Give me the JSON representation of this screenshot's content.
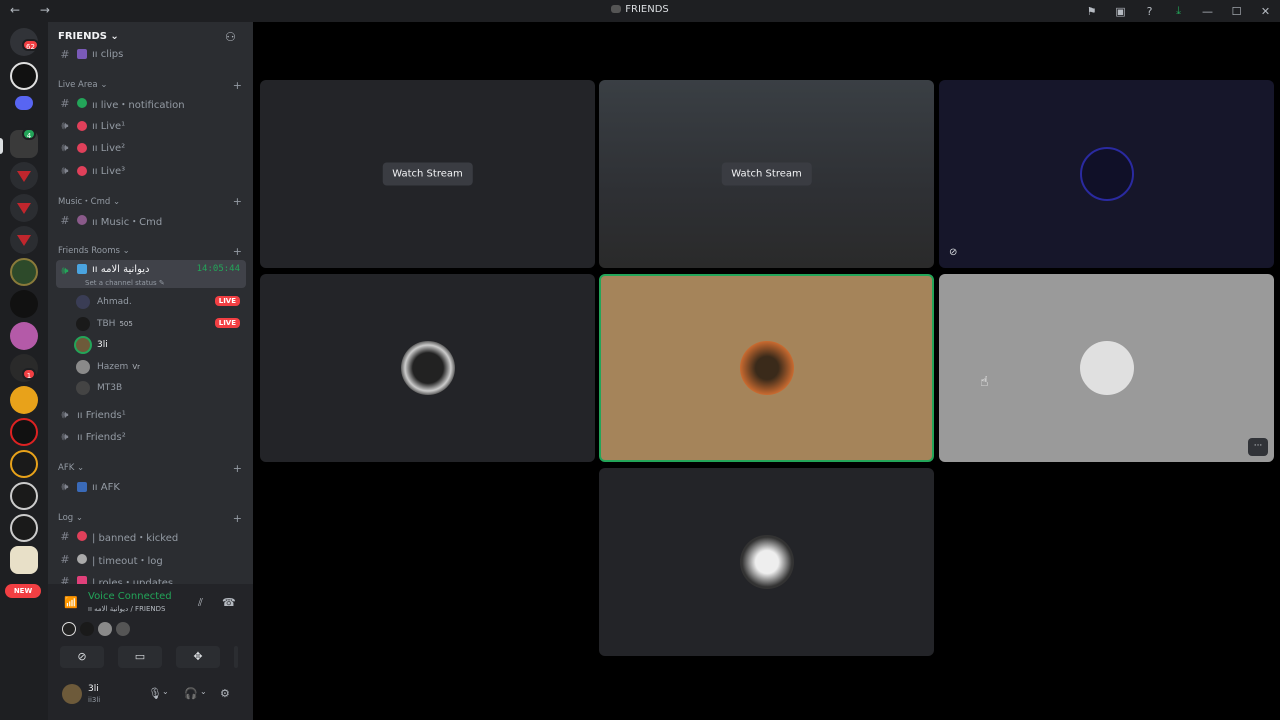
{
  "window": {
    "title": "FRIENDS",
    "nav": "← →"
  },
  "titlebar_icons": [
    "flag-icon",
    "screen-icon",
    "help-icon",
    "download-icon",
    "minimize-icon",
    "maximize-icon",
    "close-icon"
  ],
  "guilds": {
    "dm_badge": "62",
    "badge_4": "4",
    "badge_1": "1",
    "new_label": "NEW"
  },
  "server": {
    "name": "FRIENDS ⌄",
    "categories": {
      "live_area": "Live Area ⌄",
      "music": "Music・Cmd ⌄",
      "friends_rooms": "Friends Rooms ⌄",
      "afk": "AFK ⌄",
      "log": "Log ⌄"
    },
    "channels": {
      "clips": "ıı clips",
      "live_notification": "ıı live・notification",
      "live1": "ıı Live¹",
      "live2": "ıı Live²",
      "live3": "ıı Live³",
      "music_cmd": "ıı Music・Cmd",
      "diwaniya": "ıı ديوانية الامه",
      "friends1": "ıı Friends¹",
      "friends2": "ıı Friends²",
      "afk": "ıı AFK",
      "banned_kicked": "| banned・kicked",
      "timeout_log": "| timeout・log",
      "roles_updates": "| roles・updates"
    },
    "active_time": "14:05:44",
    "channel_status": "Set a channel status ✎",
    "members": [
      {
        "name": "Ahmad.",
        "live": "LIVE"
      },
      {
        "name": "TBH",
        "tag": "505",
        "live": "LIVE"
      },
      {
        "name": "3li"
      },
      {
        "name": "Hazem",
        "tag": "Vr"
      },
      {
        "name": "MT3B"
      }
    ]
  },
  "voice_panel": {
    "status": "Voice Connected",
    "location": "ıı ديوانية الامه / FRIENDS"
  },
  "user": {
    "name": "3li",
    "sub": "ii3li"
  },
  "stage": {
    "watch_label": "Watch Stream",
    "more_label": "···"
  }
}
